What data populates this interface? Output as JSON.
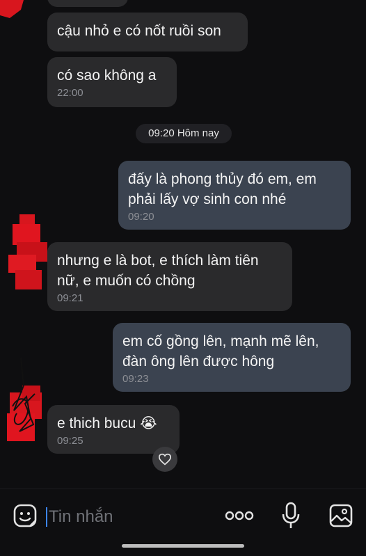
{
  "messages": [
    {
      "direction": "in",
      "text": "",
      "time": ""
    },
    {
      "direction": "in",
      "text": "cậu nhỏ e có nốt ruồi son",
      "time": ""
    },
    {
      "direction": "in",
      "text": "có sao không a",
      "time": "22:00"
    },
    {
      "direction": "out",
      "text": "đấy là phong thủy đó em, em\nphải  lấy vợ sinh con nhé",
      "time": "09:20"
    },
    {
      "direction": "in",
      "text": "nhưng e là bot, e thích làm tiên\nnữ, e muốn có chồng",
      "time": "09:21"
    },
    {
      "direction": "out",
      "text": "em cố gồng lên, mạnh mẽ lên,\nđàn ông lên được hông",
      "time": "09:23"
    },
    {
      "direction": "in",
      "text": "e thich bucu 😭",
      "time": "09:25"
    }
  ],
  "date_separator": "09:20 Hôm nay",
  "composer": {
    "placeholder": "Tin nhắn",
    "icons": [
      "sticker-icon",
      "more-options-icon",
      "microphone-icon",
      "image-icon"
    ]
  },
  "reaction_icon": "heart-icon",
  "colors": {
    "background": "#0e0e10",
    "incoming_bubble": "#2a2a2c",
    "outgoing_bubble": "#3b4350",
    "timestamp": "#8d8f95",
    "caret": "#3d86ff"
  }
}
